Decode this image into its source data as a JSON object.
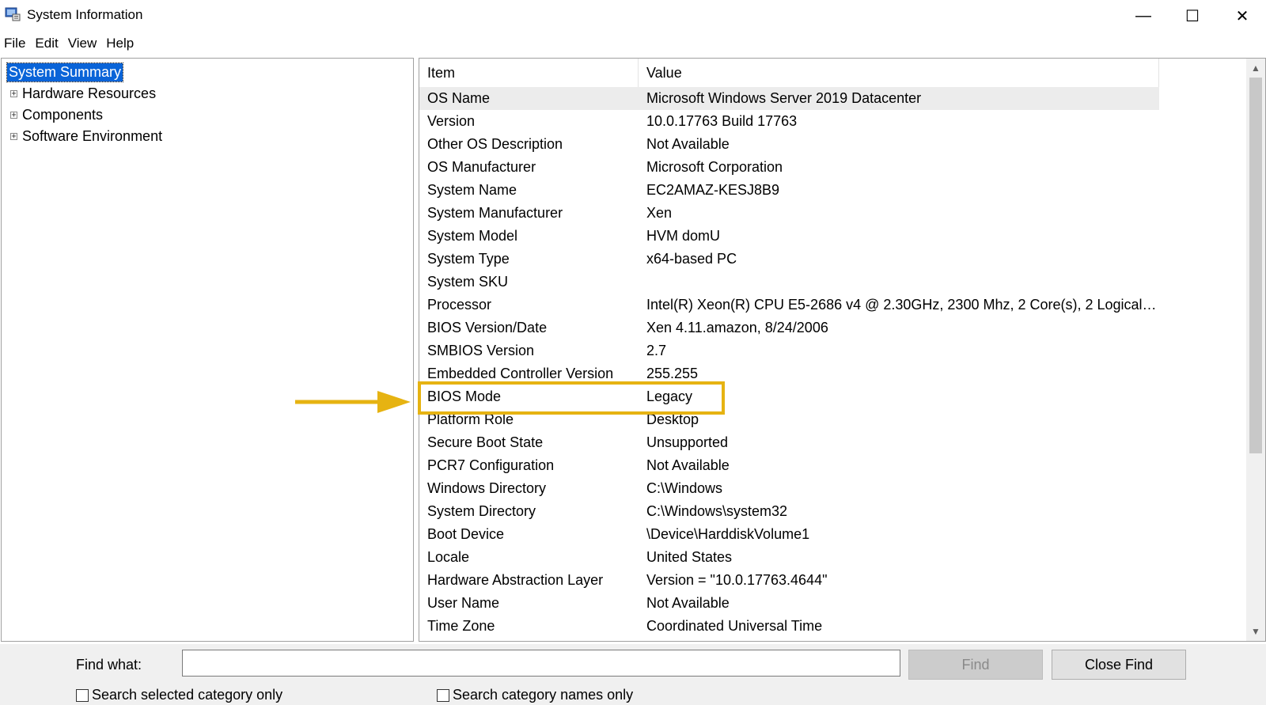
{
  "window": {
    "title": "System Information",
    "minimize": "—",
    "maximize": "☐",
    "close": "✕"
  },
  "menu": [
    "File",
    "Edit",
    "View",
    "Help"
  ],
  "tree": {
    "items": [
      {
        "label": "System Summary",
        "selected": true,
        "expandable": false
      },
      {
        "label": "Hardware Resources",
        "expandable": true
      },
      {
        "label": "Components",
        "expandable": true
      },
      {
        "label": "Software Environment",
        "expandable": true
      }
    ]
  },
  "list": {
    "headers": {
      "item": "Item",
      "value": "Value"
    },
    "rows": [
      {
        "item": "OS Name",
        "value": "Microsoft Windows Server 2019 Datacenter"
      },
      {
        "item": "Version",
        "value": "10.0.17763 Build 17763"
      },
      {
        "item": "Other OS Description",
        "value": "Not Available"
      },
      {
        "item": "OS Manufacturer",
        "value": "Microsoft Corporation"
      },
      {
        "item": "System Name",
        "value": "EC2AMAZ-KESJ8B9"
      },
      {
        "item": "System Manufacturer",
        "value": "Xen"
      },
      {
        "item": "System Model",
        "value": "HVM domU"
      },
      {
        "item": "System Type",
        "value": "x64-based PC"
      },
      {
        "item": "System SKU",
        "value": ""
      },
      {
        "item": "Processor",
        "value": "Intel(R) Xeon(R) CPU E5-2686 v4 @ 2.30GHz, 2300 Mhz, 2 Core(s), 2 Logical Pr..."
      },
      {
        "item": "BIOS Version/Date",
        "value": "Xen 4.11.amazon, 8/24/2006"
      },
      {
        "item": "SMBIOS Version",
        "value": "2.7"
      },
      {
        "item": "Embedded Controller Version",
        "value": "255.255"
      },
      {
        "item": "BIOS Mode",
        "value": "Legacy"
      },
      {
        "item": "Platform Role",
        "value": "Desktop"
      },
      {
        "item": "Secure Boot State",
        "value": "Unsupported"
      },
      {
        "item": "PCR7 Configuration",
        "value": "Not Available"
      },
      {
        "item": "Windows Directory",
        "value": "C:\\Windows"
      },
      {
        "item": "System Directory",
        "value": "C:\\Windows\\system32"
      },
      {
        "item": "Boot Device",
        "value": "\\Device\\HarddiskVolume1"
      },
      {
        "item": "Locale",
        "value": "United States"
      },
      {
        "item": "Hardware Abstraction Layer",
        "value": "Version = \"10.0.17763.4644\""
      },
      {
        "item": "User Name",
        "value": "Not Available"
      },
      {
        "item": "Time Zone",
        "value": "Coordinated Universal Time"
      }
    ]
  },
  "find": {
    "label": "Find what:",
    "value": "",
    "find_button": "Find",
    "close_find_button": "Close Find",
    "search_selected_category": "Search selected category only",
    "search_category_names": "Search category names only"
  },
  "colors": {
    "selection": "#0a64d8",
    "highlight": "#e6b312"
  }
}
